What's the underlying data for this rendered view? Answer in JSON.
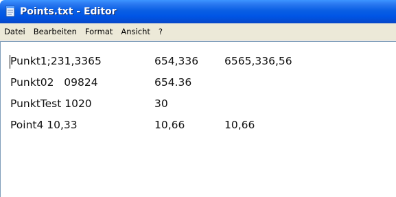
{
  "window": {
    "title": "Points.txt - Editor"
  },
  "colors": {
    "titlebar": "#0055e5",
    "menubar": "#ece9d8",
    "editor_background": "#ffffff"
  },
  "menu": {
    "items": [
      "Datei",
      "Bearbeiten",
      "Format",
      "Ansicht",
      "?"
    ]
  },
  "document": {
    "lines": [
      [
        "Punkt1;231,3365",
        "654,336",
        "6565,336,56"
      ],
      [
        "Punkt02   09824",
        "654.36",
        ""
      ],
      [
        "PunktTest 1020",
        "30",
        ""
      ],
      [
        "Point4 10,33",
        "10,66",
        "10,66"
      ]
    ]
  }
}
